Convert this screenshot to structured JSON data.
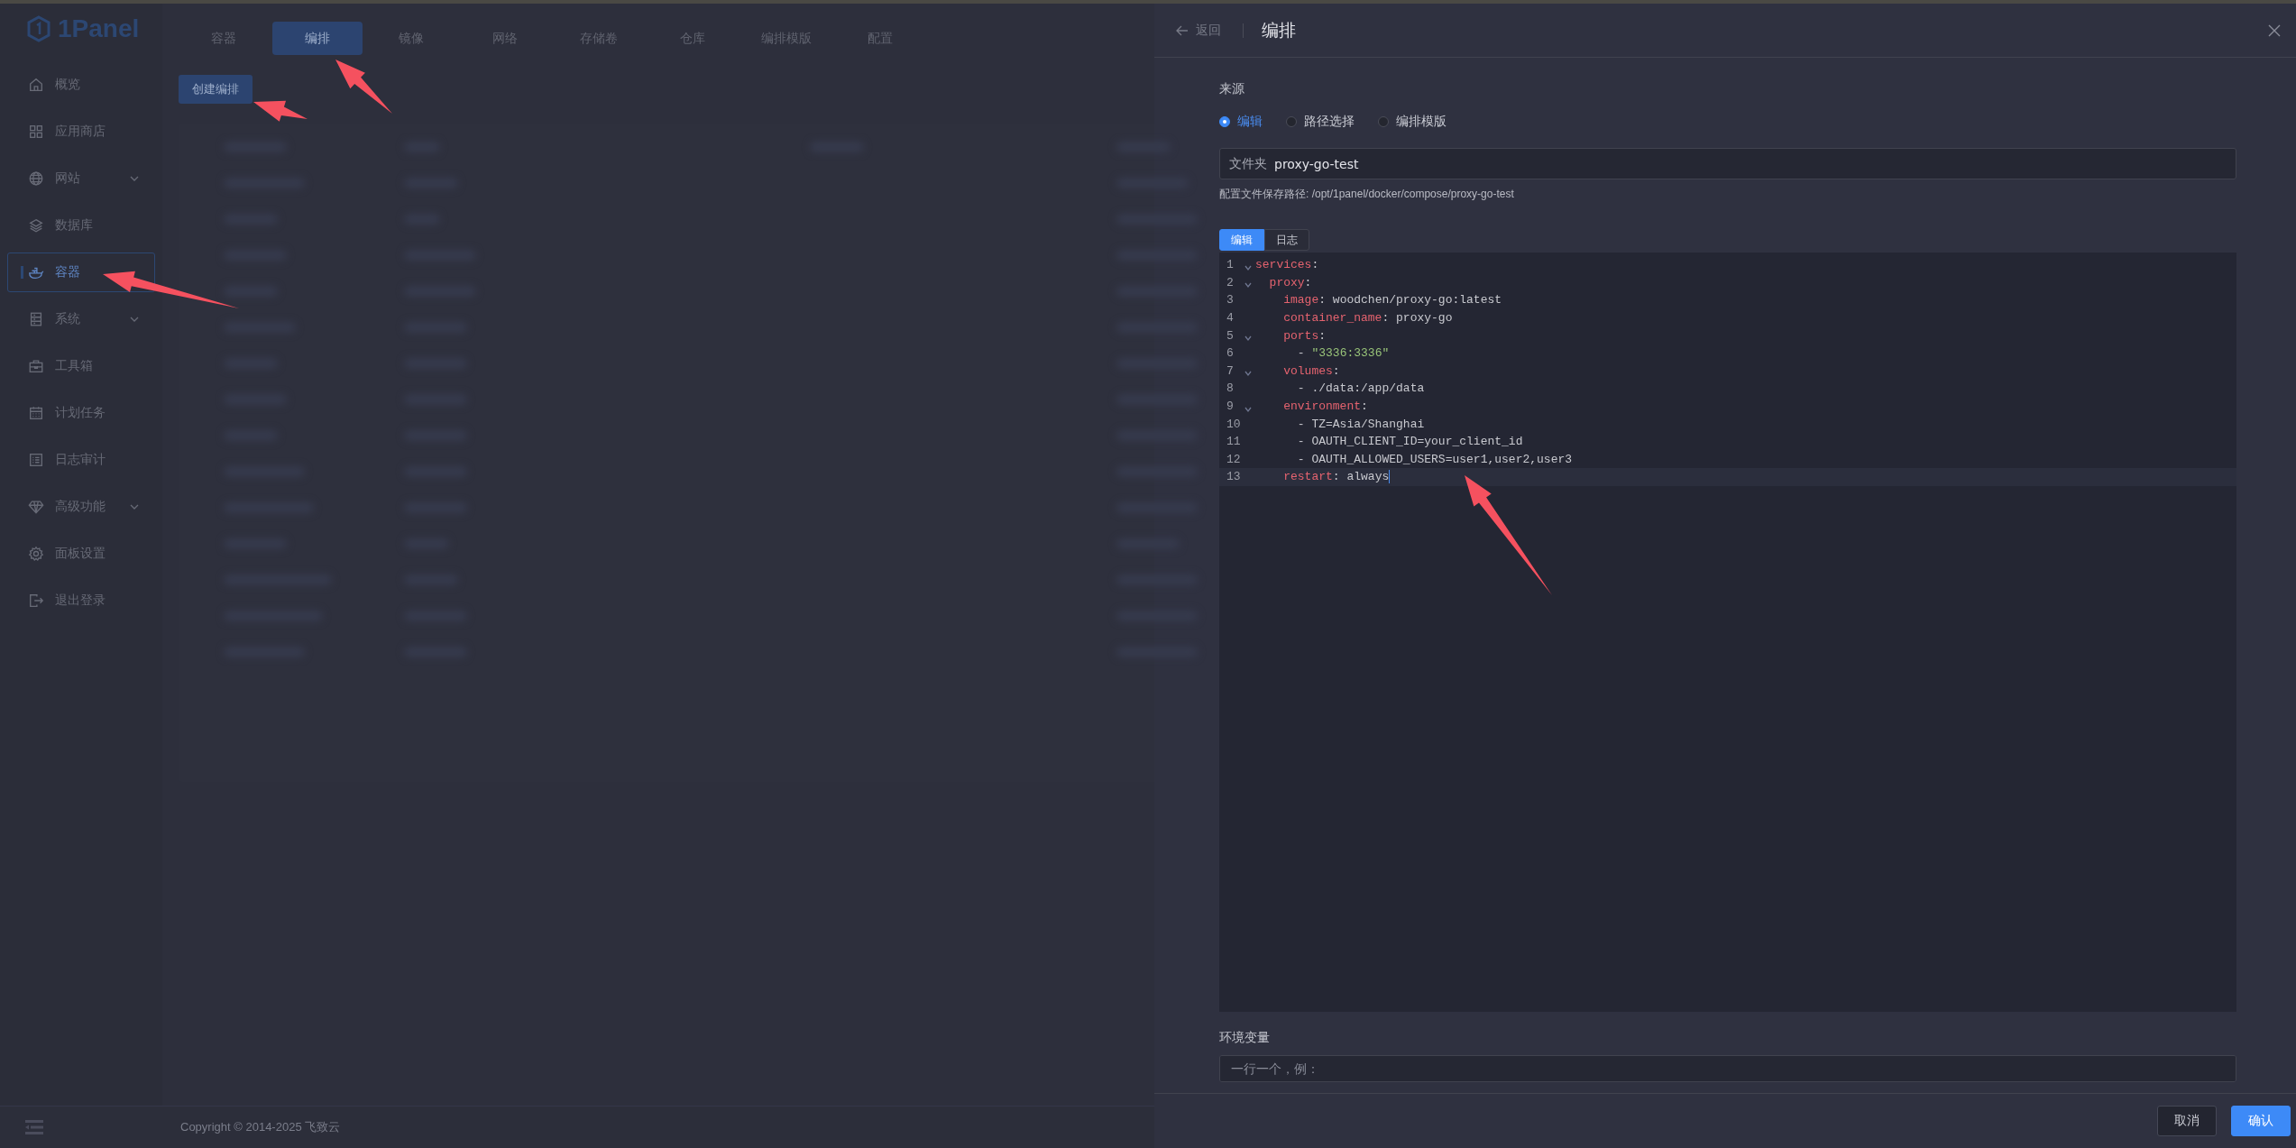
{
  "sidebar": {
    "logo": "1Panel",
    "items": [
      {
        "label": "概览",
        "expandable": false,
        "selected": false
      },
      {
        "label": "应用商店",
        "expandable": false,
        "selected": false
      },
      {
        "label": "网站",
        "expandable": true,
        "selected": false
      },
      {
        "label": "数据库",
        "expandable": false,
        "selected": false
      },
      {
        "label": "容器",
        "expandable": false,
        "selected": true
      },
      {
        "label": "系统",
        "expandable": true,
        "selected": false
      },
      {
        "label": "工具箱",
        "expandable": false,
        "selected": false
      },
      {
        "label": "计划任务",
        "expandable": false,
        "selected": false
      },
      {
        "label": "日志审计",
        "expandable": false,
        "selected": false
      },
      {
        "label": "高级功能",
        "expandable": true,
        "selected": false
      },
      {
        "label": "面板设置",
        "expandable": false,
        "selected": false
      },
      {
        "label": "退出登录",
        "expandable": false,
        "selected": false
      }
    ]
  },
  "main": {
    "tabs": [
      {
        "label": "容器",
        "selected": false
      },
      {
        "label": "编排",
        "selected": true
      },
      {
        "label": "镜像",
        "selected": false
      },
      {
        "label": "网络",
        "selected": false
      },
      {
        "label": "存储卷",
        "selected": false
      },
      {
        "label": "仓库",
        "selected": false
      },
      {
        "label": "编排模版",
        "selected": false
      },
      {
        "label": "配置",
        "selected": false
      }
    ],
    "create_button": "创建编排",
    "copyright": "Copyright © 2014-2025 飞致云"
  },
  "drawer": {
    "back": "返回",
    "title": "编排",
    "source_label": "来源",
    "radios": [
      {
        "label": "编辑",
        "selected": true
      },
      {
        "label": "路径选择",
        "selected": false
      },
      {
        "label": "编排模版",
        "selected": false
      }
    ],
    "folder": {
      "prefix": "文件夹",
      "value": "proxy-go-test"
    },
    "hint": "配置文件保存路径: /opt/1panel/docker/compose/proxy-go-test",
    "editor_tabs": [
      {
        "label": "编辑",
        "selected": true
      },
      {
        "label": "日志",
        "selected": false
      }
    ],
    "lines": [
      {
        "no": "1",
        "foldable": true,
        "active": false,
        "tokens": [
          {
            "kind": "key",
            "text": "services"
          },
          {
            "kind": "punct",
            "text": ":"
          }
        ]
      },
      {
        "no": "2",
        "foldable": true,
        "active": false,
        "tokens": [
          {
            "kind": "key",
            "text": "  proxy"
          },
          {
            "kind": "punct",
            "text": ":"
          }
        ]
      },
      {
        "no": "3",
        "foldable": false,
        "active": false,
        "tokens": [
          {
            "kind": "key",
            "text": "    image"
          },
          {
            "kind": "punct",
            "text": ": "
          },
          {
            "kind": "plain",
            "text": "woodchen/proxy-go:latest"
          }
        ]
      },
      {
        "no": "4",
        "foldable": false,
        "active": false,
        "tokens": [
          {
            "kind": "key",
            "text": "    container_name"
          },
          {
            "kind": "punct",
            "text": ": "
          },
          {
            "kind": "plain",
            "text": "proxy-go"
          }
        ]
      },
      {
        "no": "5",
        "foldable": true,
        "active": false,
        "tokens": [
          {
            "kind": "key",
            "text": "    ports"
          },
          {
            "kind": "punct",
            "text": ":"
          }
        ]
      },
      {
        "no": "6",
        "foldable": false,
        "active": false,
        "tokens": [
          {
            "kind": "plain",
            "text": "      - "
          },
          {
            "kind": "string",
            "text": "\"3336:3336\""
          }
        ]
      },
      {
        "no": "7",
        "foldable": true,
        "active": false,
        "tokens": [
          {
            "kind": "key",
            "text": "    volumes"
          },
          {
            "kind": "punct",
            "text": ":"
          }
        ]
      },
      {
        "no": "8",
        "foldable": false,
        "active": false,
        "tokens": [
          {
            "kind": "plain",
            "text": "      - ./data:/app/data"
          }
        ]
      },
      {
        "no": "9",
        "foldable": true,
        "active": false,
        "tokens": [
          {
            "kind": "key",
            "text": "    environment"
          },
          {
            "kind": "punct",
            "text": ":"
          }
        ]
      },
      {
        "no": "10",
        "foldable": false,
        "active": false,
        "tokens": [
          {
            "kind": "plain",
            "text": "      - TZ=Asia/Shanghai"
          }
        ]
      },
      {
        "no": "11",
        "foldable": false,
        "active": false,
        "tokens": [
          {
            "kind": "plain",
            "text": "      - OAUTH_CLIENT_ID=your_client_id"
          }
        ]
      },
      {
        "no": "12",
        "foldable": false,
        "active": false,
        "tokens": [
          {
            "kind": "plain",
            "text": "      - OAUTH_ALLOWED_USERS=user1,user2,user3"
          }
        ]
      },
      {
        "no": "13",
        "foldable": false,
        "active": true,
        "tokens": [
          {
            "kind": "key",
            "text": "    restart"
          },
          {
            "kind": "punct",
            "text": ": "
          },
          {
            "kind": "plain",
            "text": "always"
          }
        ]
      }
    ],
    "env_label": "环境变量",
    "env_placeholder": "一行一个，例：",
    "cancel": "取消",
    "confirm": "确认"
  }
}
